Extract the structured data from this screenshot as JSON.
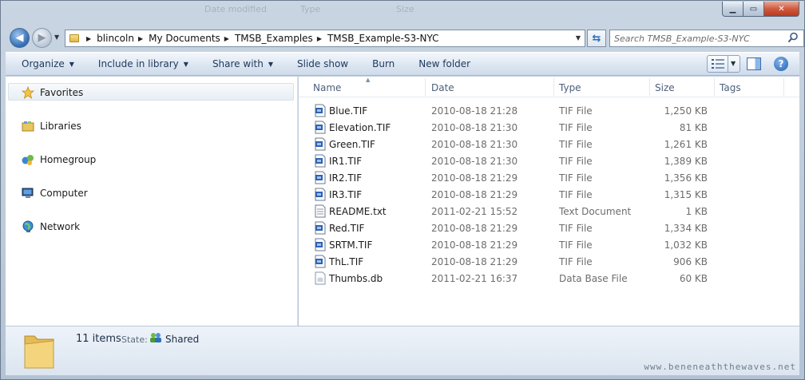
{
  "window": {
    "ghost_headers": [
      "Date modified",
      "Type",
      "Size"
    ]
  },
  "caption_buttons": {
    "minimize": "▁",
    "maximize": "▭",
    "close": "✕"
  },
  "address_bar": {
    "breadcrumbs": [
      "blincoln",
      "My Documents",
      "TMSB_Examples",
      "TMSB_Example-S3-NYC"
    ]
  },
  "search": {
    "placeholder": "Search TMSB_Example-S3-NYC"
  },
  "toolbar": {
    "organize": "Organize",
    "include_in_library": "Include in library",
    "share_with": "Share with",
    "slide_show": "Slide show",
    "burn": "Burn",
    "new_folder": "New folder",
    "help": "?"
  },
  "sidebar": {
    "items": [
      {
        "label": "Favorites",
        "icon": "star-icon"
      },
      {
        "label": "Libraries",
        "icon": "libraries-icon"
      },
      {
        "label": "Homegroup",
        "icon": "homegroup-icon"
      },
      {
        "label": "Computer",
        "icon": "computer-icon"
      },
      {
        "label": "Network",
        "icon": "network-icon"
      }
    ]
  },
  "file_list": {
    "columns": {
      "name": "Name",
      "date": "Date",
      "type": "Type",
      "size": "Size",
      "tags": "Tags"
    },
    "rows": [
      {
        "name": "Blue.TIF",
        "date": "2010-08-18 21:28",
        "type": "TIF File",
        "size": "1,250 KB",
        "icon": "tif-file-icon"
      },
      {
        "name": "Elevation.TIF",
        "date": "2010-08-18 21:30",
        "type": "TIF File",
        "size": "81 KB",
        "icon": "tif-file-icon"
      },
      {
        "name": "Green.TIF",
        "date": "2010-08-18 21:30",
        "type": "TIF File",
        "size": "1,261 KB",
        "icon": "tif-file-icon"
      },
      {
        "name": "IR1.TIF",
        "date": "2010-08-18 21:30",
        "type": "TIF File",
        "size": "1,389 KB",
        "icon": "tif-file-icon"
      },
      {
        "name": "IR2.TIF",
        "date": "2010-08-18 21:29",
        "type": "TIF File",
        "size": "1,356 KB",
        "icon": "tif-file-icon"
      },
      {
        "name": "IR3.TIF",
        "date": "2010-08-18 21:29",
        "type": "TIF File",
        "size": "1,315 KB",
        "icon": "tif-file-icon"
      },
      {
        "name": "README.txt",
        "date": "2011-02-21 15:52",
        "type": "Text Document",
        "size": "1 KB",
        "icon": "text-file-icon"
      },
      {
        "name": "Red.TIF",
        "date": "2010-08-18 21:29",
        "type": "TIF File",
        "size": "1,334 KB",
        "icon": "tif-file-icon"
      },
      {
        "name": "SRTM.TIF",
        "date": "2010-08-18 21:29",
        "type": "TIF File",
        "size": "1,032 KB",
        "icon": "tif-file-icon"
      },
      {
        "name": "ThL.TIF",
        "date": "2010-08-18 21:29",
        "type": "TIF File",
        "size": "906 KB",
        "icon": "tif-file-icon"
      },
      {
        "name": "Thumbs.db",
        "date": "2011-02-21 16:37",
        "type": "Data Base File",
        "size": "60 KB",
        "icon": "database-file-icon"
      }
    ]
  },
  "details_pane": {
    "items_count": "11 items",
    "state_label": "State:",
    "state_value": "Shared"
  },
  "watermark": "www.beneneaththewaves.net"
}
